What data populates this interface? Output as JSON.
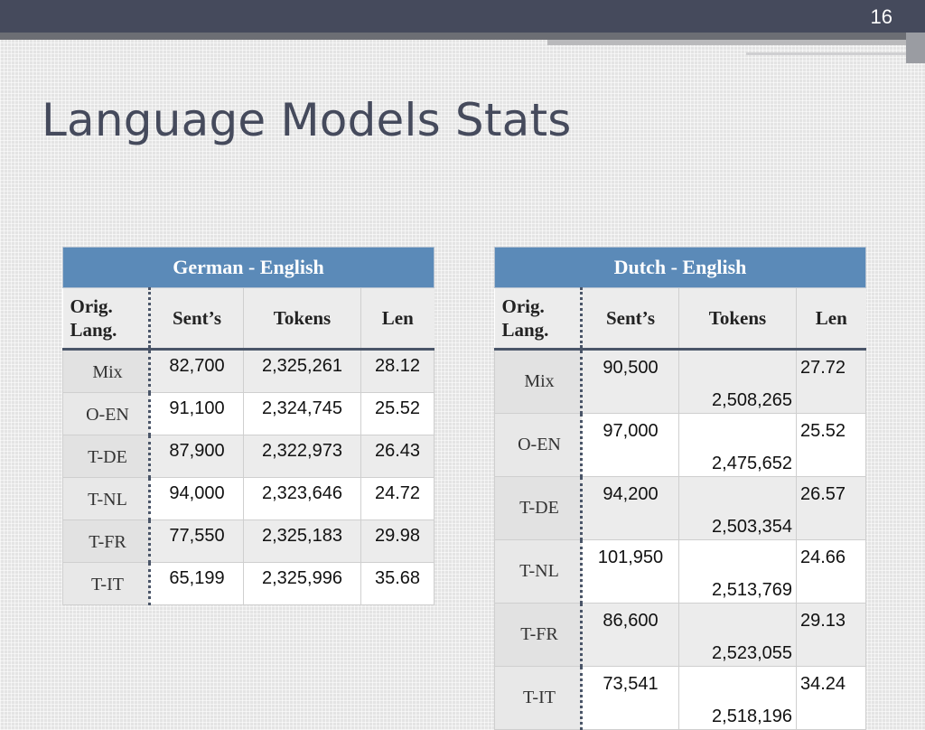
{
  "slide": {
    "number": "16",
    "title": "Language Models Stats"
  },
  "columns": {
    "orig": [
      "Orig.",
      "Lang."
    ],
    "sents": "Sent’s",
    "tokens": "Tokens",
    "len": "Len"
  },
  "tables": [
    {
      "caption": "German - English",
      "rows": [
        {
          "lang": "Mix",
          "sents": "82,700",
          "tokens": "2,325,261",
          "len": "28.12"
        },
        {
          "lang": "O-EN",
          "sents": "91,100",
          "tokens": "2,324,745",
          "len": "25.52"
        },
        {
          "lang": "T-DE",
          "sents": "87,900",
          "tokens": "2,322,973",
          "len": "26.43"
        },
        {
          "lang": "T-NL",
          "sents": "94,000",
          "tokens": "2,323,646",
          "len": "24.72"
        },
        {
          "lang": "T-FR",
          "sents": "77,550",
          "tokens": "2,325,183",
          "len": "29.98"
        },
        {
          "lang": "T-IT",
          "sents": "65,199",
          "tokens": "2,325,996",
          "len": "35.68"
        }
      ]
    },
    {
      "caption": "Dutch - English",
      "rows": [
        {
          "lang": "Mix",
          "sents": "90,500",
          "tokens": "2,508,265",
          "len": "27.72"
        },
        {
          "lang": "O-EN",
          "sents": "97,000",
          "tokens": "2,475,652",
          "len": "25.52"
        },
        {
          "lang": "T-DE",
          "sents": "94,200",
          "tokens": "2,503,354",
          "len": "26.57"
        },
        {
          "lang": "T-NL",
          "sents": "101,950",
          "tokens": "2,513,769",
          "len": "24.66"
        },
        {
          "lang": "T-FR",
          "sents": "86,600",
          "tokens": "2,523,055",
          "len": "29.13"
        },
        {
          "lang": "T-IT",
          "sents": "73,541",
          "tokens": "2,518,196",
          "len": "34.24"
        }
      ]
    }
  ]
}
